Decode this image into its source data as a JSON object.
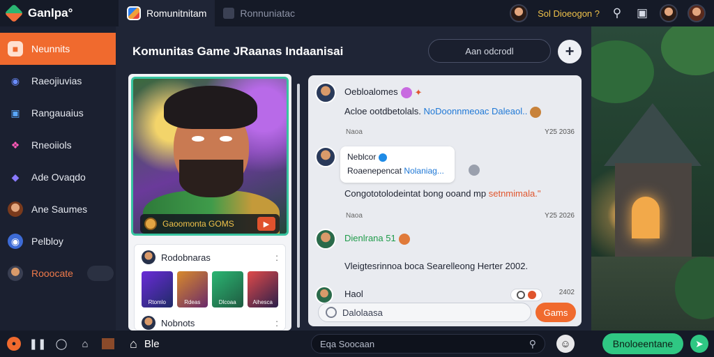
{
  "app": {
    "name": "Ganlpa°"
  },
  "tabs": [
    {
      "label": "Romunitnitam",
      "active": true
    },
    {
      "label": "Ronnuniatac",
      "active": false
    }
  ],
  "user": {
    "label": "Sol Dioeogon ?"
  },
  "sidebar": {
    "items": [
      {
        "label": "Neunnits",
        "icon": "home-icon",
        "active": true
      },
      {
        "label": "Raeojiuvias",
        "icon": "compass-icon",
        "active": false
      },
      {
        "label": "Rangauaius",
        "icon": "monitor-icon",
        "active": false
      },
      {
        "label": "Rneoiiols",
        "icon": "gem-icon",
        "active": false
      },
      {
        "label": "Ade Ovaqdo",
        "icon": "crystal-icon",
        "active": false
      },
      {
        "label": "Ane Saumes",
        "icon": "avatar-icon",
        "active": false
      },
      {
        "label": "Pelbloy",
        "icon": "shield-icon",
        "active": false
      },
      {
        "label": "Rooocate",
        "icon": "live-icon",
        "active": false
      }
    ]
  },
  "main": {
    "title": "Komunitas Game JRaanas Indaanisai",
    "add_friend_label": "Aan odcrodl",
    "plus_label": "+"
  },
  "game_card": {
    "badge_label": "Gaoomonta GOMS",
    "panel1_title": "Rodobnaras",
    "panel1_menu": ":",
    "thumbs": [
      "Rtomlo",
      "Rdeas",
      "Dlcoaa",
      "Aihesca"
    ],
    "panel2_title": "Nobnots",
    "panel2_menu": ":"
  },
  "chat": {
    "messages": [
      {
        "name": "Oebloalomes",
        "text_prefix": "Acloe ootdbetolals.",
        "text_highlight": "NoDoonnmeoac Daleaol..",
        "meta": "Naoa",
        "time": "Y25 2036"
      },
      {
        "bubble_title": "Neblcor",
        "bubble_sub_prefix": "Roaenepencat",
        "bubble_sub_highlight": "Nolaniag...",
        "text_prefix": "Congototolodeintat bong ooand mp",
        "text_highlight": "setnmimala.\"",
        "meta": "Naoa",
        "time": "Y25 2026"
      },
      {
        "name": "Dienlrana 51",
        "text": "Vleigtesrinnoa boca Searelleong Herter 2002.",
        "meta": "",
        "time": ""
      },
      {
        "name": "Haol",
        "time": "2402"
      }
    ],
    "input_placeholder": "Dalolaasa",
    "send_label": "Gams"
  },
  "bottombar": {
    "home_label": "Ble",
    "search_placeholder": "Eqa Soocaan",
    "cta_label": "Bnoloeentane"
  },
  "colors": {
    "accent": "#f06a2e",
    "success": "#2fc783",
    "background": "#1f2536"
  }
}
